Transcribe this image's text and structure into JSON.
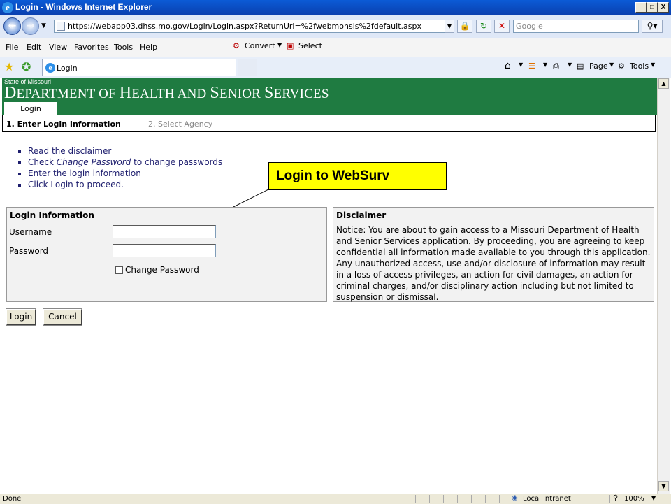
{
  "window": {
    "title": "Login - Windows Internet Explorer",
    "controls": [
      "_",
      "□",
      "X"
    ]
  },
  "navigation": {
    "address_url": "https://webapp03.dhss.mo.gov/Login/Login.aspx?ReturnUrl=%2fwebmohsis%2fdefault.aspx",
    "search_placeholder": "Google"
  },
  "menu": {
    "items": [
      "File",
      "Edit",
      "View",
      "Favorites",
      "Tools",
      "Help"
    ],
    "convert_label": "Convert",
    "select_label": "Select"
  },
  "favorites_bar": {
    "tab_label": "Login",
    "page_label": "Page",
    "tools_label": "Tools"
  },
  "banner": {
    "state": "State of Missouri",
    "dept_parts": [
      {
        "big": "D",
        "small": "EPARTMENT OF "
      },
      {
        "big": "H",
        "small": "EALTH AND "
      },
      {
        "big": "S",
        "small": "ENIOR "
      },
      {
        "big": "S",
        "small": "ERVICES"
      }
    ],
    "active_tab": "Login"
  },
  "steps": {
    "step1": "1. Enter Login Information",
    "step2": "2. Select Agency"
  },
  "instructions": {
    "item1": "Read the disclaimer",
    "item2_pre": "Check ",
    "item2_em": "Change Password",
    "item2_post": " to change passwords",
    "item3": "Enter the login information",
    "item4": "Click Login to proceed."
  },
  "callout": {
    "text": "Login to WebSurv"
  },
  "login_panel": {
    "heading": "Login Information",
    "username_label": "Username",
    "username_value": "",
    "password_label": "Password",
    "password_value": "",
    "change_password_label": "Change Password",
    "change_password_checked": false
  },
  "disclaimer": {
    "heading": "Disclaimer",
    "text": "Notice: You are about to gain access to a Missouri Department of Health and Senior Services application.  By proceeding, you are agreeing to keep confidential all information made available to you through this application.  Any unauthorized access, use and/or disclosure of information may result in a loss of access privileges, an action for civil damages, an action for criminal charges, and/or disciplinary action including but not limited to suspension or dismissal."
  },
  "buttons": {
    "login": "Login",
    "cancel": "Cancel"
  },
  "status": {
    "left": "Done",
    "zone": "Local intranet",
    "zoom": "100%"
  }
}
